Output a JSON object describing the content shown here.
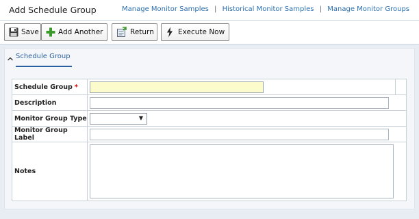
{
  "header": {
    "title": "Add Schedule Group",
    "links": [
      "Manage Monitor Samples",
      "Historical Monitor Samples",
      "Manage Monitor Groups"
    ],
    "separator": "|"
  },
  "toolbar": {
    "save": "Save",
    "add_another": "Add Another",
    "return": "Return",
    "execute_now": "Execute Now"
  },
  "panel": {
    "tab": "Schedule Group"
  },
  "form": {
    "schedule_group_label": "Schedule Group",
    "required_marker": "*",
    "schedule_group_value": "",
    "description_label": "Description",
    "description_value": "",
    "monitor_group_type_label": "Monitor Group Type",
    "monitor_group_type_value": "",
    "monitor_group_label_label": "Monitor Group Label",
    "monitor_group_label_value": "",
    "notes_label": "Notes",
    "notes_value": ""
  },
  "colors": {
    "link": "#2a6fb0",
    "required": "#dd0000",
    "highlight_input": "#fbfbcc",
    "add_icon": "#3a9a2a"
  },
  "icons": {
    "save": "floppy-disk-icon",
    "add_another": "green-plus-icon",
    "return": "return-document-icon",
    "execute_now": "lightning-icon",
    "collapse": "chevron-up-icon"
  }
}
